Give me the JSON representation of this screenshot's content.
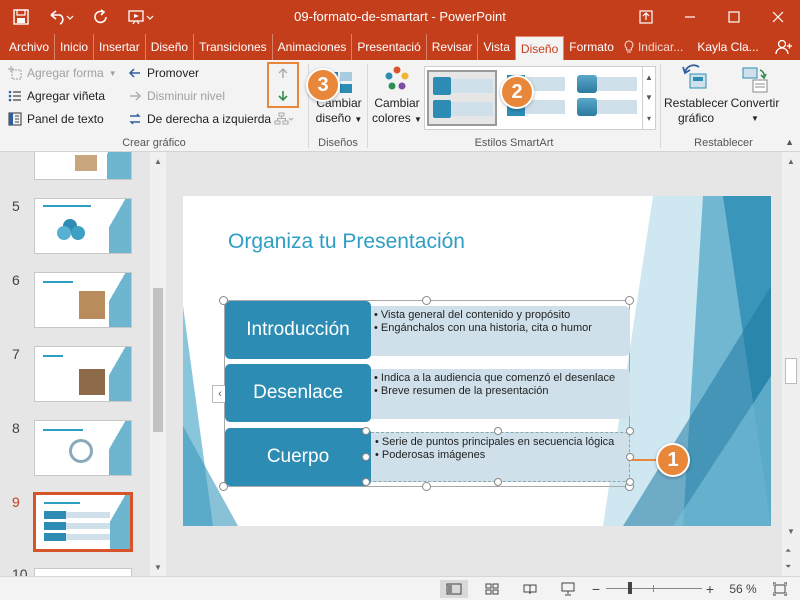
{
  "window": {
    "title": "09-formato-de-smartart - PowerPoint",
    "controls": [
      "ribbon-display-icon",
      "minimize-icon",
      "maximize-icon",
      "close-icon"
    ]
  },
  "quick_access": [
    "save-icon",
    "undo-icon",
    "redo-icon",
    "start-from-beginning-icon"
  ],
  "tabs": [
    {
      "label": "Archivo"
    },
    {
      "label": "Inicio"
    },
    {
      "label": "Insertar"
    },
    {
      "label": "Diseño"
    },
    {
      "label": "Transiciones"
    },
    {
      "label": "Animaciones"
    },
    {
      "label": "Presentació"
    },
    {
      "label": "Revisar"
    },
    {
      "label": "Vista"
    },
    {
      "label": "Diseño",
      "active": true
    },
    {
      "label": "Formato"
    }
  ],
  "tell_me": "Indicar...",
  "user": "Kayla Cla...",
  "ribbon": {
    "crear_grafico": {
      "label": "Crear gráfico",
      "add_shape": "Agregar forma",
      "add_bullet": "Agregar viñeta",
      "text_pane": "Panel de texto",
      "promote": "Promover",
      "demote": "Disminuir nivel",
      "rtl": "De derecha a izquierda"
    },
    "disenos": {
      "label": "Diseños",
      "change_layout_1": "Cambiar",
      "change_layout_2": "diseño"
    },
    "estilos": {
      "label": "Estilos SmartArt",
      "change_colors_1": "Cambiar",
      "change_colors_2": "colores"
    },
    "restablecer": {
      "label": "Restablecer",
      "reset_1": "Restablecer",
      "reset_2": "gráfico",
      "convert": "Convertir"
    }
  },
  "slides": [
    {
      "num": "5"
    },
    {
      "num": "6"
    },
    {
      "num": "7"
    },
    {
      "num": "8"
    },
    {
      "num": "9",
      "selected": true
    },
    {
      "num": "10"
    }
  ],
  "slide": {
    "title": "Organiza tu Presentación",
    "rows": [
      {
        "label": "Introducción",
        "bullets": [
          "Vista general del contenido y propósito",
          "Engánchalos con una historia, cita o humor"
        ]
      },
      {
        "label": "Desenlace",
        "bullets": [
          "Indica a la audiencia que comenzó el desenlace",
          "Breve resumen de la presentación"
        ]
      },
      {
        "label": "Cuerpo",
        "bullets": [
          "Serie de puntos principales en secuencia lógica",
          "Poderosas imágenes"
        ]
      }
    ]
  },
  "callouts": [
    "1",
    "2",
    "3"
  ],
  "statusbar": {
    "zoom_minus": "−",
    "zoom_plus": "+",
    "zoom": "56 %"
  },
  "colors": {
    "accent": "#c43e1c",
    "smartart_blue": "#2c8cb4",
    "callout_orange": "#e8863a"
  }
}
